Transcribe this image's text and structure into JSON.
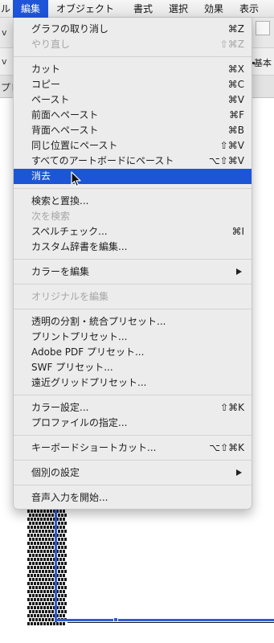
{
  "menubar": {
    "items": [
      {
        "label": "ル",
        "active": false
      },
      {
        "label": "編集",
        "active": true
      },
      {
        "label": "オブジェクト",
        "active": false
      },
      {
        "label": "書式",
        "active": false
      },
      {
        "label": "選択",
        "active": false
      },
      {
        "label": "効果",
        "active": false
      },
      {
        "label": "表示",
        "active": false
      }
    ]
  },
  "background": {
    "left_chevron": "v",
    "left_pu": "プレ",
    "right_label": "基本"
  },
  "edit_menu": {
    "items": [
      {
        "label": "グラフの取り消し",
        "shortcut": "⌘Z"
      },
      {
        "label": "やり直し",
        "shortcut": "⇧⌘Z",
        "disabled": true
      },
      {
        "label": "カット",
        "shortcut": "⌘X"
      },
      {
        "label": "コピー",
        "shortcut": "⌘C"
      },
      {
        "label": "ペースト",
        "shortcut": "⌘V"
      },
      {
        "label": "前面へペースト",
        "shortcut": "⌘F"
      },
      {
        "label": "背面へペースト",
        "shortcut": "⌘B"
      },
      {
        "label": "同じ位置にペースト",
        "shortcut": "⇧⌘V"
      },
      {
        "label": "すべてのアートボードにペースト",
        "shortcut": "⌥⇧⌘V"
      },
      {
        "label": "消去",
        "shortcut": "",
        "highlighted": true
      },
      {
        "label": "検索と置換...",
        "shortcut": ""
      },
      {
        "label": "次を検索",
        "shortcut": "",
        "disabled": true
      },
      {
        "label": "スペルチェック...",
        "shortcut": "⌘I"
      },
      {
        "label": "カスタム辞書を編集...",
        "shortcut": ""
      },
      {
        "label": "カラーを編集",
        "shortcut": "",
        "submenu": true
      },
      {
        "label": "オリジナルを編集",
        "shortcut": "",
        "disabled": true
      },
      {
        "label": "透明の分割・統合プリセット...",
        "shortcut": ""
      },
      {
        "label": "プリントプリセット...",
        "shortcut": ""
      },
      {
        "label": "Adobe PDF プリセット...",
        "shortcut": ""
      },
      {
        "label": "SWF プリセット...",
        "shortcut": ""
      },
      {
        "label": "遠近グリッドプリセット...",
        "shortcut": ""
      },
      {
        "label": "カラー設定...",
        "shortcut": "⇧⌘K"
      },
      {
        "label": "プロファイルの指定...",
        "shortcut": ""
      },
      {
        "label": "キーボードショートカット...",
        "shortcut": "⌥⇧⌘K"
      },
      {
        "label": "個別の設定",
        "shortcut": "",
        "submenu": true
      },
      {
        "label": "音声入力を開始...",
        "shortcut": ""
      }
    ]
  },
  "colors": {
    "highlight": "#1c55d6",
    "menu_bg": "#ececec",
    "disabled_text": "#a6a6a6",
    "selection": "#2f5bd7"
  }
}
